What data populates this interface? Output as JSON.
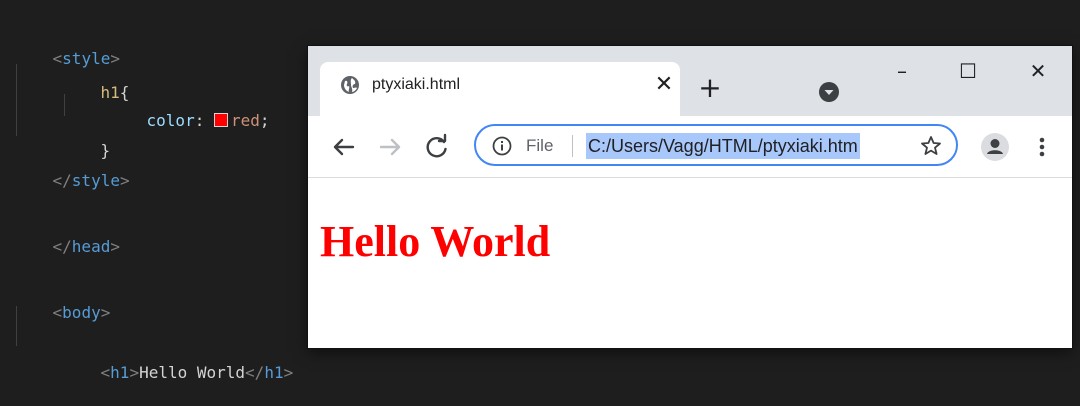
{
  "editor": {
    "lines": [
      {
        "open": "<",
        "tag": "style",
        "close": ">"
      },
      {
        "selector": "h1",
        "brace": "{"
      },
      {
        "prop": "color",
        "colon": ":",
        "value": "red",
        "semi": ";"
      },
      {
        "brace": "}"
      },
      {
        "open": "</",
        "tag": "style",
        "close": ">"
      },
      {
        "open": "</",
        "tag": "head",
        "close": ">"
      },
      {
        "open": "<",
        "tag": "body",
        "close": ">"
      },
      {
        "open": "<",
        "tag": "h1",
        "close": ">",
        "text": "Hello World",
        "end_open": "</",
        "end_tag": "h1",
        "end_close": ">"
      }
    ]
  },
  "browser": {
    "tab": {
      "title": "ptyxiaki.html",
      "close": "✕"
    },
    "new_tab": "+",
    "window_controls": {
      "minimize": "–",
      "maximize": "☐",
      "close": "✕"
    },
    "address_bar": {
      "scheme": "File",
      "url": "C:/Users/Vagg/HTML/ptyxiaki.htm"
    },
    "page": {
      "heading": "Hello World",
      "heading_color": "#ff0000"
    }
  },
  "colors": {
    "accent": "#4285f4",
    "selection": "#a8c7fa"
  }
}
